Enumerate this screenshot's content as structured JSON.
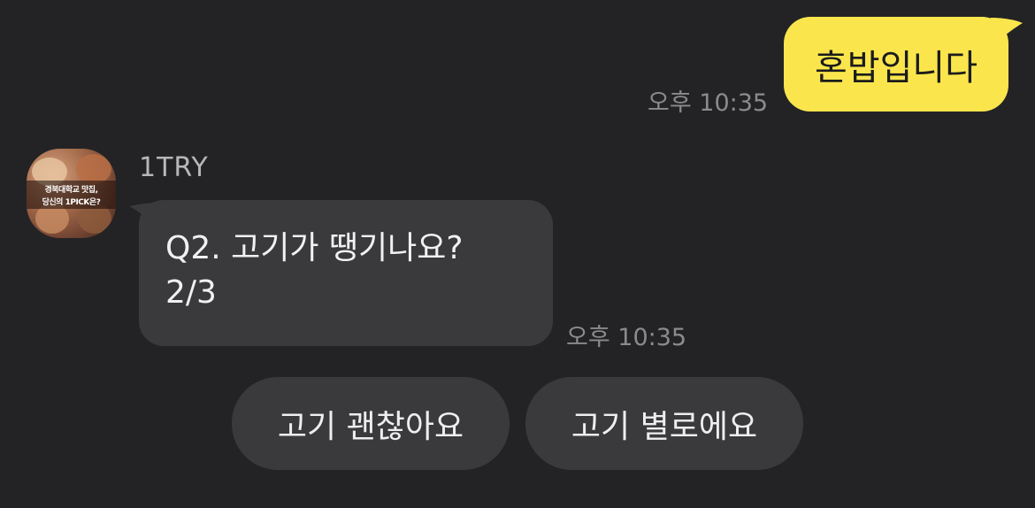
{
  "outgoing": {
    "text": "혼밥입니다",
    "time": "오후 10:35",
    "bubble_color": "#FAE64C"
  },
  "incoming": {
    "sender": "1TRY",
    "avatar": {
      "line1": "경북대학교 맛집,",
      "line2": "당신의 1PICK은?"
    },
    "lines": [
      "Q2. 고기가 땡기나요?",
      "2/3"
    ],
    "time": "오후 10:35",
    "bubble_color": "#3a3a3d"
  },
  "quick_replies": [
    {
      "label": "고기 괜찮아요"
    },
    {
      "label": "고기 별로에요"
    }
  ],
  "colors": {
    "background": "#232325"
  }
}
